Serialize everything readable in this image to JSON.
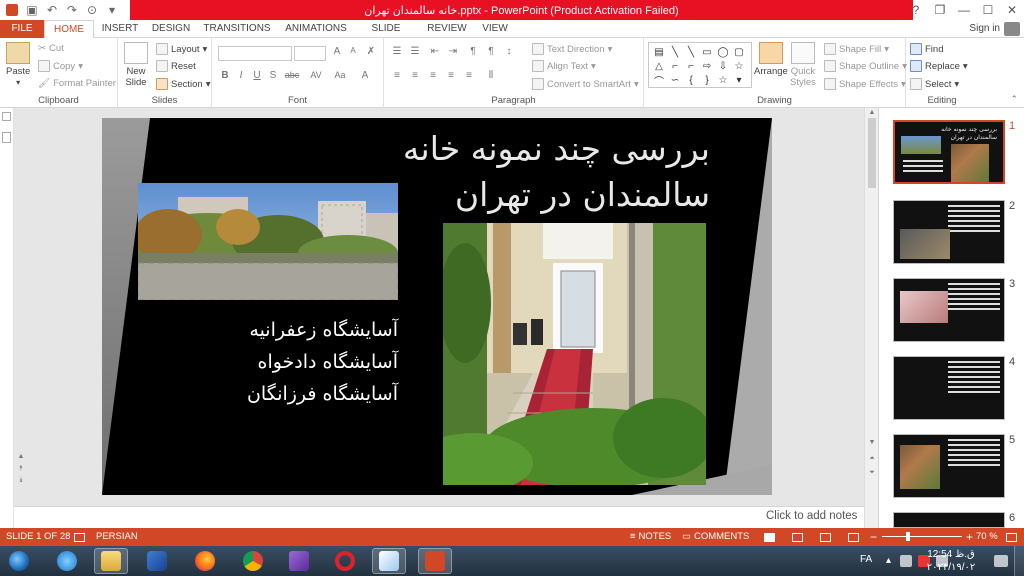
{
  "window": {
    "title": "خانه سالمندان تهران.pptx -  PowerPoint (Product Activation Failed)",
    "help": "?",
    "controls": {
      "restore": "❐",
      "minimize": "—",
      "maximize": "☐",
      "close": "✕"
    }
  },
  "tabs": [
    "FILE",
    "HOME",
    "INSERT",
    "DESIGN",
    "TRANSITIONS",
    "ANIMATIONS",
    "SLIDE SHOW",
    "REVIEW",
    "VIEW"
  ],
  "account": {
    "sign_in": "Sign in"
  },
  "ribbon": {
    "clipboard": {
      "label": "Clipboard",
      "paste": "Paste",
      "cut": "Cut",
      "copy": "Copy",
      "format_painter": "Format Painter"
    },
    "slides": {
      "label": "Slides",
      "new_slide": "New",
      "new_slide2": "Slide",
      "layout": "Layout",
      "reset": "Reset",
      "section": "Section"
    },
    "font": {
      "label": "Font",
      "bold": "B",
      "italic": "I",
      "underline": "U",
      "shadow": "S",
      "strike": "abc",
      "spacing": "AV",
      "case": "Aa",
      "color": "A"
    },
    "paragraph": {
      "label": "Paragraph",
      "text_direction": "Text Direction",
      "align_text": "Align Text",
      "convert": "Convert to SmartArt"
    },
    "drawing": {
      "label": "Drawing",
      "arrange": "Arrange",
      "quick_styles": "Quick",
      "quick_styles2": "Styles",
      "shape_fill": "Shape Fill",
      "shape_outline": "Shape Outline",
      "shape_effects": "Shape Effects"
    },
    "editing": {
      "label": "Editing",
      "find": "Find",
      "replace": "Replace",
      "select": "Select"
    }
  },
  "slide": {
    "title_line1": "بررسی چند نمونه خانه",
    "title_line2": "سالمندان در تهران",
    "bullets": [
      "آسایشگاه زعفرانیه",
      "آسایشگاه دادخواه",
      "آسایشگاه فرزانگان"
    ]
  },
  "notes": {
    "placeholder": "Click to add notes"
  },
  "thumbnails": [
    {
      "num": "1",
      "title": "بررسی چند نمونه خانه سالمندان در تهران"
    },
    {
      "num": "2"
    },
    {
      "num": "3"
    },
    {
      "num": "4"
    },
    {
      "num": "5"
    },
    {
      "num": "6"
    }
  ],
  "status": {
    "slide": "SLIDE 1 OF 28",
    "language": "PERSIAN",
    "notes": "NOTES",
    "comments": "COMMENTS",
    "zoom": "70 %",
    "zoom_minus": "−",
    "zoom_plus": "+"
  },
  "taskbar": {
    "lang": "FA",
    "time": "12:54 ق.ظ",
    "date": "۲۰۲۴/۱۹/۰۲"
  }
}
